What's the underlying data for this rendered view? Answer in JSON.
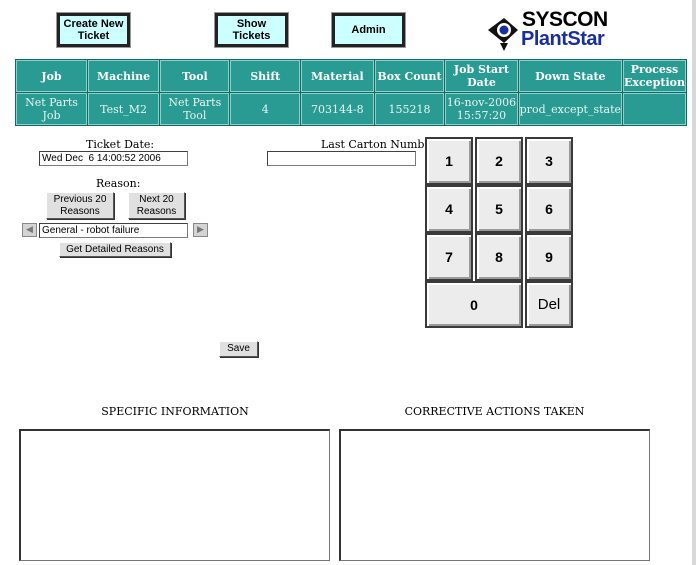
{
  "nav": {
    "create_ticket": "Create New Ticket",
    "show_tickets": "Show Tickets",
    "admin": "Admin"
  },
  "logo": {
    "line1": "SYSCON",
    "line2": "PlantStar"
  },
  "table": {
    "headers": [
      "Job",
      "Machine",
      "Tool",
      "Shift",
      "Material",
      "Box Count",
      "Job Start Date",
      "Down State",
      "Process Exception"
    ],
    "row": [
      "Net Parts Job",
      "Test_M2",
      "Net Parts Tool",
      "4",
      "703144-8",
      "155218",
      "16-nov-2006 15:57:20",
      "prod_except_state",
      ""
    ]
  },
  "ticket_date": {
    "label": "Ticket Date:",
    "value": "Wed Dec  6 14:00:52 2006"
  },
  "last_carton": {
    "label": "Last Carton Number:",
    "value": ""
  },
  "reason": {
    "label": "Reason:",
    "prev_button": "Previous 20 Reasons",
    "next_button": "Next 20 Reasons",
    "selected": "General - robot failure",
    "detail_button": "Get Detailed Reasons"
  },
  "keypad": {
    "keys": [
      "1",
      "2",
      "3",
      "4",
      "5",
      "6",
      "7",
      "8",
      "9",
      "0"
    ],
    "del": "Del"
  },
  "save_button": "Save",
  "specific_info": {
    "heading": "SPECIFIC INFORMATION",
    "value": ""
  },
  "corrective": {
    "heading": "CORRECTIVE ACTIONS TAKEN",
    "value": ""
  },
  "colors": {
    "table_bg": "#2a9b92",
    "nav_button_bg": "#ccffff",
    "logo_blue": "#1a2f9e"
  }
}
